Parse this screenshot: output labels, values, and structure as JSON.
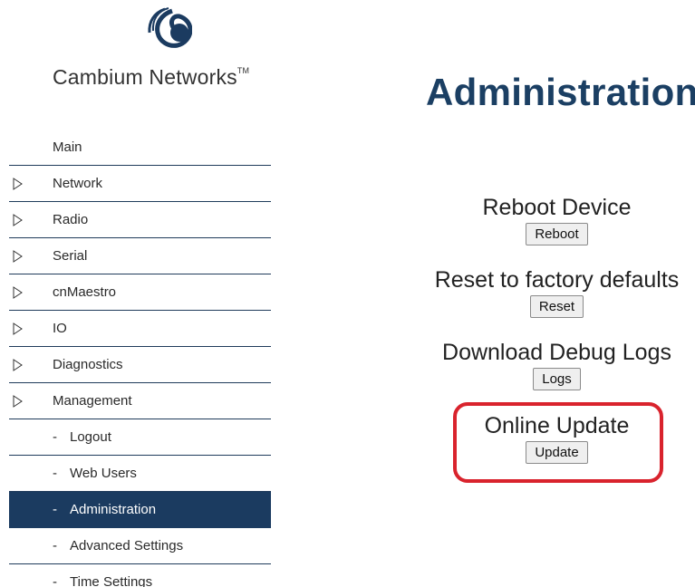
{
  "brand": {
    "name": "Cambium Networks",
    "trademark": "TM",
    "logo_icon": "cambium-wave-icon"
  },
  "page": {
    "title": "Administration"
  },
  "sidebar": {
    "items": [
      {
        "label": "Main",
        "type": "top"
      },
      {
        "label": "Network",
        "type": "group",
        "icon": "triangle-right-icon"
      },
      {
        "label": "Radio",
        "type": "group",
        "icon": "triangle-right-icon"
      },
      {
        "label": "Serial",
        "type": "group",
        "icon": "triangle-right-icon"
      },
      {
        "label": "cnMaestro",
        "type": "group",
        "icon": "triangle-right-icon"
      },
      {
        "label": "IO",
        "type": "group",
        "icon": "triangle-right-icon"
      },
      {
        "label": "Diagnostics",
        "type": "group",
        "icon": "triangle-right-icon"
      },
      {
        "label": "Management",
        "type": "group",
        "icon": "triangle-right-icon"
      },
      {
        "label": "Logout",
        "type": "sub",
        "prefix": "-"
      },
      {
        "label": "Web Users",
        "type": "sub",
        "prefix": "-"
      },
      {
        "label": "Administration",
        "type": "sub",
        "prefix": "-",
        "active": true
      },
      {
        "label": "Advanced Settings",
        "type": "sub",
        "prefix": "-"
      },
      {
        "label": "Time Settings",
        "type": "sub",
        "prefix": "-"
      }
    ]
  },
  "actions": {
    "reboot": {
      "heading": "Reboot Device",
      "button": "Reboot"
    },
    "reset": {
      "heading": "Reset to factory defaults",
      "button": "Reset"
    },
    "logs": {
      "heading": "Download Debug Logs",
      "button": "Logs"
    },
    "update": {
      "heading": "Online Update",
      "button": "Update"
    }
  },
  "colors": {
    "accent": "#1b3b60",
    "highlight": "#d9232d"
  }
}
